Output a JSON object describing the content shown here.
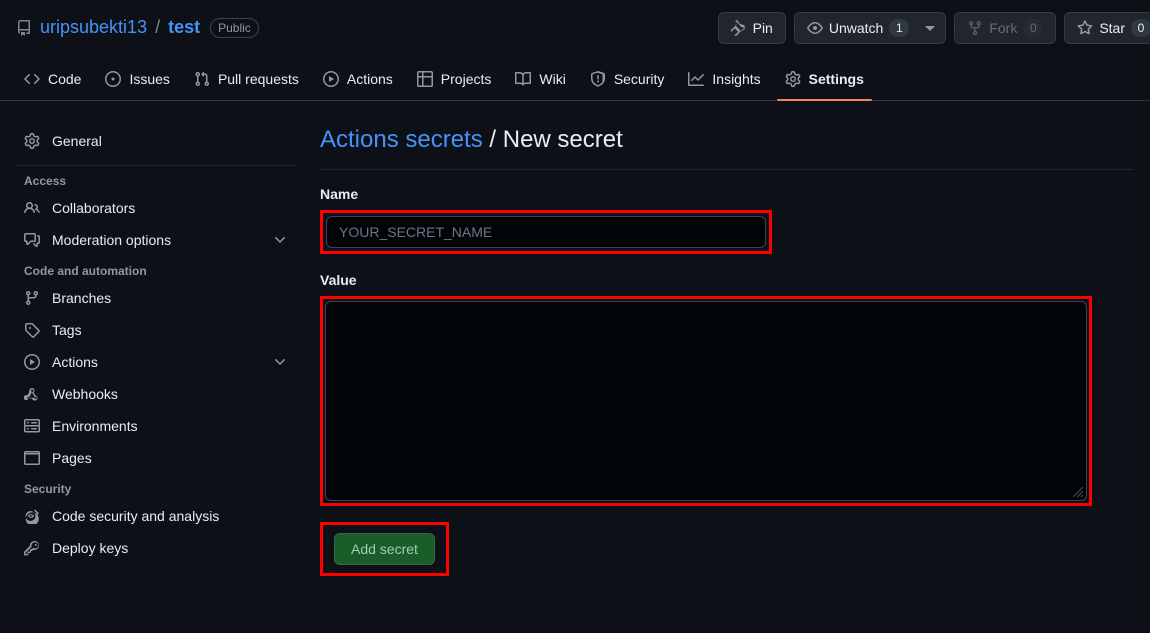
{
  "repo": {
    "icon": "repo-icon",
    "owner": "uripsubekti13",
    "separator": "/",
    "name": "test",
    "visibility": "Public"
  },
  "header_actions": {
    "pin": {
      "label": "Pin",
      "icon": "pin-icon"
    },
    "unwatch": {
      "label": "Unwatch",
      "count": "1",
      "icon": "eye-icon"
    },
    "fork": {
      "label": "Fork",
      "count": "0",
      "icon": "fork-icon",
      "disabled": true
    },
    "star": {
      "label": "Star",
      "count": "0",
      "icon": "star-icon"
    }
  },
  "nav": {
    "tabs": [
      {
        "label": "Code",
        "icon": "code-icon",
        "selected": false
      },
      {
        "label": "Issues",
        "icon": "issue-opened-icon",
        "selected": false
      },
      {
        "label": "Pull requests",
        "icon": "git-pull-request-icon",
        "selected": false
      },
      {
        "label": "Actions",
        "icon": "play-icon",
        "selected": false
      },
      {
        "label": "Projects",
        "icon": "table-icon",
        "selected": false
      },
      {
        "label": "Wiki",
        "icon": "book-icon",
        "selected": false
      },
      {
        "label": "Security",
        "icon": "shield-icon",
        "selected": false
      },
      {
        "label": "Insights",
        "icon": "graph-icon",
        "selected": false
      },
      {
        "label": "Settings",
        "icon": "gear-icon",
        "selected": true
      }
    ]
  },
  "sidebar": {
    "general": {
      "label": "General",
      "icon": "gear-icon"
    },
    "groups": [
      {
        "title": "Access",
        "items": [
          {
            "label": "Collaborators",
            "icon": "people-icon",
            "chevron": false
          },
          {
            "label": "Moderation options",
            "icon": "comment-discussion-icon",
            "chevron": true
          }
        ]
      },
      {
        "title": "Code and automation",
        "items": [
          {
            "label": "Branches",
            "icon": "git-branch-icon",
            "chevron": false
          },
          {
            "label": "Tags",
            "icon": "tag-icon",
            "chevron": false
          },
          {
            "label": "Actions",
            "icon": "play-icon",
            "chevron": true
          },
          {
            "label": "Webhooks",
            "icon": "webhook-icon",
            "chevron": false
          },
          {
            "label": "Environments",
            "icon": "server-icon",
            "chevron": false
          },
          {
            "label": "Pages",
            "icon": "browser-icon",
            "chevron": false
          }
        ]
      },
      {
        "title": "Security",
        "items": [
          {
            "label": "Code security and analysis",
            "icon": "codescan-icon",
            "chevron": false
          },
          {
            "label": "Deploy keys",
            "icon": "key-icon",
            "chevron": false
          }
        ]
      }
    ]
  },
  "main": {
    "breadcrumb_link": "Actions secrets",
    "breadcrumb_separator": " / ",
    "breadcrumb_current": "New secret",
    "name_label": "Name",
    "name_value": "",
    "name_placeholder": "YOUR_SECRET_NAME",
    "value_label": "Value",
    "value_value": "",
    "value_placeholder": "",
    "submit_label": "Add secret"
  },
  "colors": {
    "page_background": "#0d1117",
    "input_background": "#010409",
    "link": "#4493f8",
    "accent_underline": "#f78166",
    "annotation": "#ff0000",
    "primary_button": "#238636"
  }
}
